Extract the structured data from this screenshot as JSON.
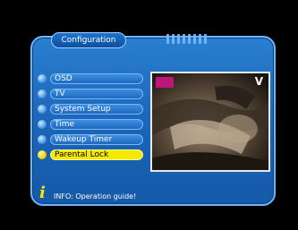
{
  "header": {
    "title": "Configuration"
  },
  "menu": {
    "items": [
      {
        "label": "OSD"
      },
      {
        "label": "TV"
      },
      {
        "label": "System Setup"
      },
      {
        "label": "Time"
      },
      {
        "label": "Wakeup Timer"
      },
      {
        "label": "Parental Lock"
      }
    ],
    "selected_label": "Parental Lock"
  },
  "preview": {
    "channel_logo": "V"
  },
  "footer": {
    "info_icon": "info-icon",
    "info_text": "INFO: Operation guide!"
  },
  "colors": {
    "panel": "#1b64b6",
    "highlight": "#f6e900",
    "text": "#ffffff"
  }
}
